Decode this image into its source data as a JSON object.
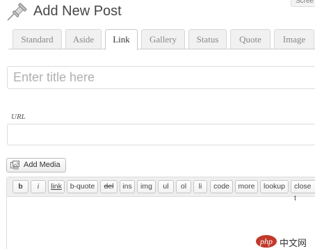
{
  "header": {
    "title": "Add New Post",
    "title_icon": "pushpin-icon",
    "screen_options_label": "Scree"
  },
  "tabs": [
    {
      "label": "Standard",
      "active": false
    },
    {
      "label": "Aside",
      "active": false
    },
    {
      "label": "Link",
      "active": true
    },
    {
      "label": "Gallery",
      "active": false
    },
    {
      "label": "Status",
      "active": false
    },
    {
      "label": "Quote",
      "active": false
    },
    {
      "label": "Image",
      "active": false
    }
  ],
  "title_field": {
    "value": "",
    "placeholder": "Enter title here"
  },
  "url_field": {
    "label": "URL",
    "value": ""
  },
  "media": {
    "add_media_label": "Add Media",
    "icon": "media-icon"
  },
  "editor": {
    "quicktags": [
      "b",
      "i",
      "link",
      "b-quote",
      "del",
      "ins",
      "img",
      "ul",
      "ol",
      "li",
      "code",
      "more",
      "lookup",
      "close t"
    ],
    "content": ""
  },
  "watermark": {
    "logo": "php",
    "text": "中文网"
  },
  "colors": {
    "tab_active_bg": "#ffffff",
    "tab_inactive_bg": "#f1f1f1",
    "border": "#dcdcdc",
    "toolbar_bg": "#efefef"
  }
}
